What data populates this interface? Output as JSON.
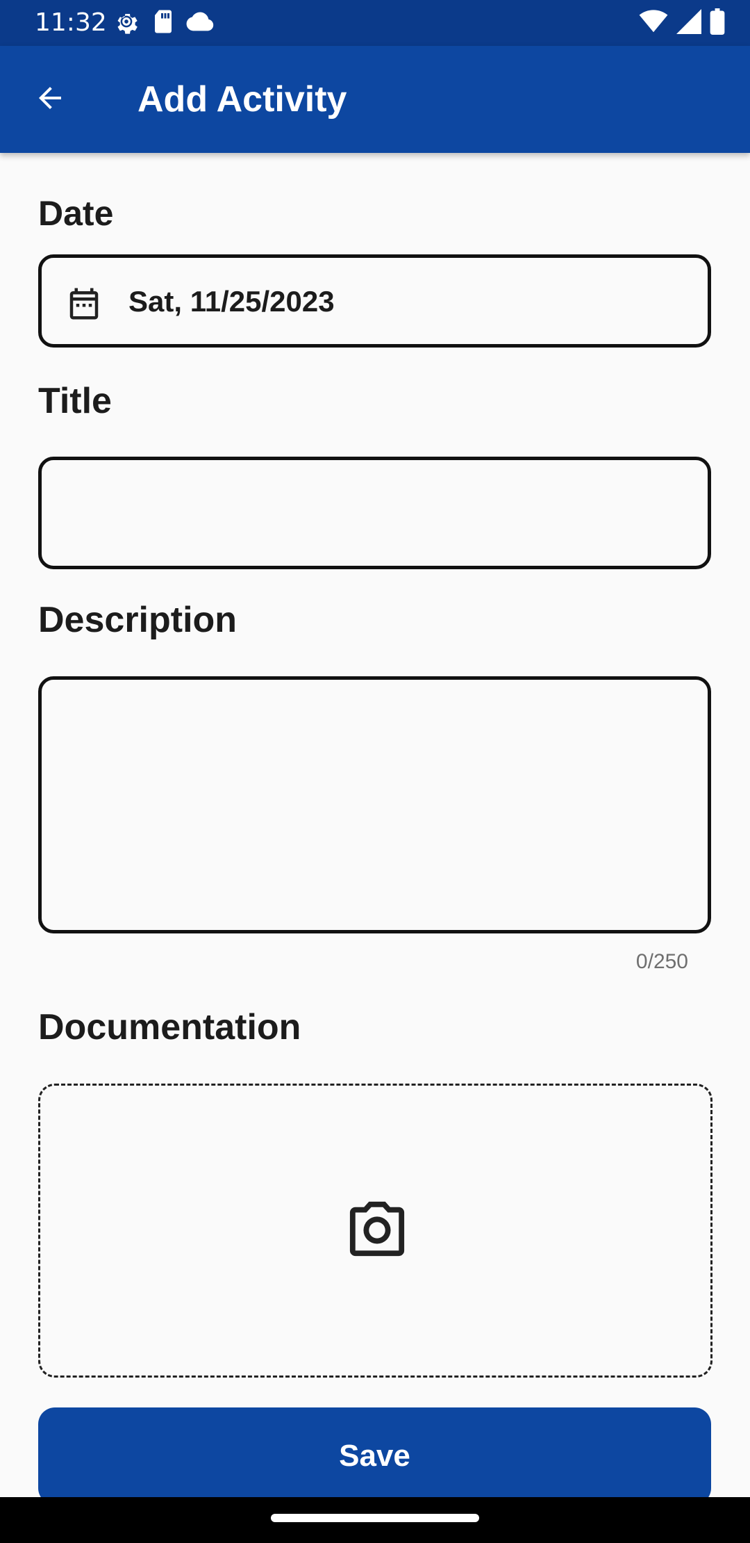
{
  "status_bar": {
    "time": "11:32",
    "left_icons": [
      "settings-gear-icon",
      "sd-card-icon",
      "cloud-icon"
    ],
    "right_icons": [
      "wifi-icon",
      "cell-signal-icon",
      "battery-icon"
    ]
  },
  "app_bar": {
    "title": "Add Activity",
    "back_icon": "arrow-back-icon"
  },
  "form": {
    "date": {
      "label": "Date",
      "value": "Sat, 11/25/2023",
      "icon": "calendar-icon"
    },
    "title": {
      "label": "Title",
      "value": ""
    },
    "description": {
      "label": "Description",
      "value": "",
      "counter": "0/250"
    },
    "documentation": {
      "label": "Documentation",
      "icon": "camera-icon"
    },
    "save_label": "Save"
  },
  "colors": {
    "status_bar": "#0b3a8a",
    "primary": "#0d47a1",
    "background": "#fafafa",
    "border": "#111111"
  }
}
